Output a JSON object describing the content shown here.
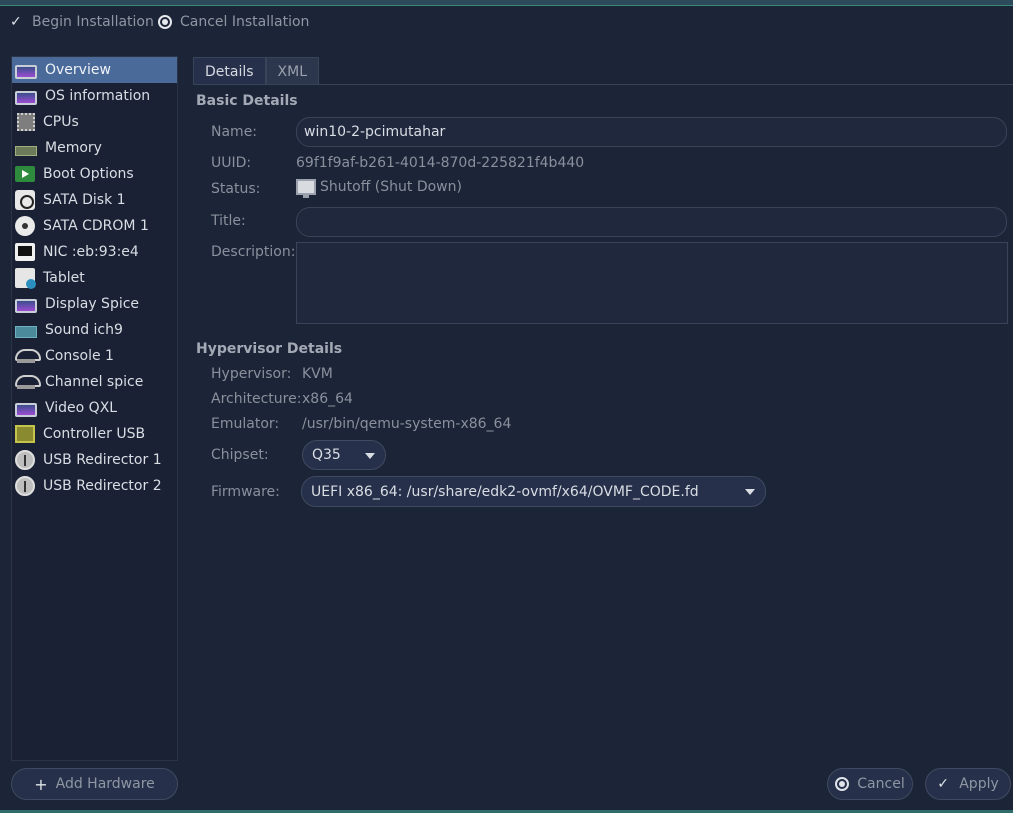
{
  "toolbar": {
    "begin_label": "Begin Installation",
    "cancel_label": "Cancel Installation"
  },
  "sidebar": {
    "items": [
      {
        "label": "Overview",
        "icon": "monitor-icon",
        "selected": true
      },
      {
        "label": "OS information",
        "icon": "monitor-icon"
      },
      {
        "label": "CPUs",
        "icon": "cpu-icon"
      },
      {
        "label": "Memory",
        "icon": "memory-icon"
      },
      {
        "label": "Boot Options",
        "icon": "boot-icon"
      },
      {
        "label": "SATA Disk 1",
        "icon": "disk-icon"
      },
      {
        "label": "SATA CDROM 1",
        "icon": "cdrom-icon"
      },
      {
        "label": "NIC :eb:93:e4",
        "icon": "network-icon"
      },
      {
        "label": "Tablet",
        "icon": "tablet-icon"
      },
      {
        "label": "Display Spice",
        "icon": "display-icon"
      },
      {
        "label": "Sound ich9",
        "icon": "sound-card-icon"
      },
      {
        "label": "Console 1",
        "icon": "console-icon"
      },
      {
        "label": "Channel spice",
        "icon": "channel-icon"
      },
      {
        "label": "Video QXL",
        "icon": "video-icon"
      },
      {
        "label": "Controller USB",
        "icon": "usb-controller-icon"
      },
      {
        "label": "USB Redirector 1",
        "icon": "usb-redirector-icon"
      },
      {
        "label": "USB Redirector 2",
        "icon": "usb-redirector-icon"
      }
    ],
    "add_hardware_label": "Add Hardware"
  },
  "tabs": {
    "details": "Details",
    "xml": "XML"
  },
  "basic": {
    "section_title": "Basic Details",
    "name_label": "Name:",
    "name_value": "win10-2-pcimutahar",
    "uuid_label": "UUID:",
    "uuid_value": "69f1f9af-b261-4014-870d-225821f4b440",
    "status_label": "Status:",
    "status_value": "Shutoff (Shut Down)",
    "title_label": "Title:",
    "title_value": "",
    "description_label": "Description:",
    "description_value": ""
  },
  "hypervisor": {
    "section_title": "Hypervisor Details",
    "hypervisor_label": "Hypervisor:",
    "hypervisor_value": "KVM",
    "architecture_label": "Architecture:",
    "architecture_value": "x86_64",
    "emulator_label": "Emulator:",
    "emulator_value": "/usr/bin/qemu-system-x86_64",
    "chipset_label": "Chipset:",
    "chipset_value": "Q35",
    "firmware_label": "Firmware:",
    "firmware_value": "UEFI x86_64: /usr/share/edk2-ovmf/x64/OVMF_CODE.fd"
  },
  "footer": {
    "cancel_label": "Cancel",
    "apply_label": "Apply"
  },
  "colors": {
    "background": "#1c2437",
    "selection": "#4a6a9a",
    "field_bg": "#1f283d"
  }
}
